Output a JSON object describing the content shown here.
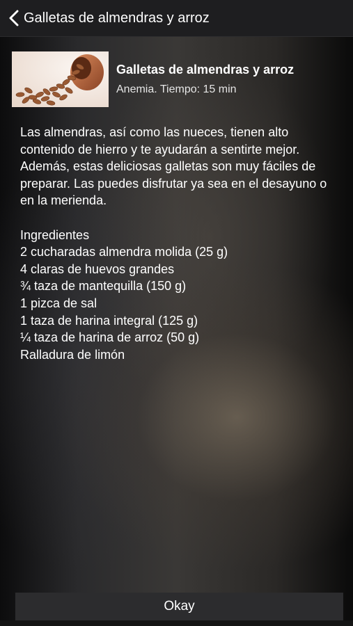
{
  "nav": {
    "back_icon": "chevron-left-icon",
    "title": "Galletas de almendras y arroz"
  },
  "recipe": {
    "image_icon": "almonds-photo",
    "title": "Galletas de almendras y arroz",
    "meta": "Anemia. Tiempo: 15 min",
    "description": "Las almendras, así como las nueces, tienen alto contenido de hierro y te ayudarán a sentirte mejor. Además, estas deliciosas galletas son muy fáciles de preparar. Las puedes disfrutar ya sea en el desayuno o en la merienda.",
    "ingredients_title": "Ingredientes",
    "ingredients": [
      "2 cucharadas almendra molida (25 g)",
      "4 claras de huevos grandes",
      "¾ taza de mantequilla (150 g)",
      "1 pizca de sal",
      "1 taza de harina integral (125 g)",
      "¼ taza de harina de arroz (50 g)",
      "Ralladura de limón"
    ]
  },
  "footer": {
    "okay_label": "Okay"
  },
  "colors": {
    "nav_background": "#1e1e20",
    "button_background": "#2c2c2e",
    "text": "#ffffff"
  }
}
